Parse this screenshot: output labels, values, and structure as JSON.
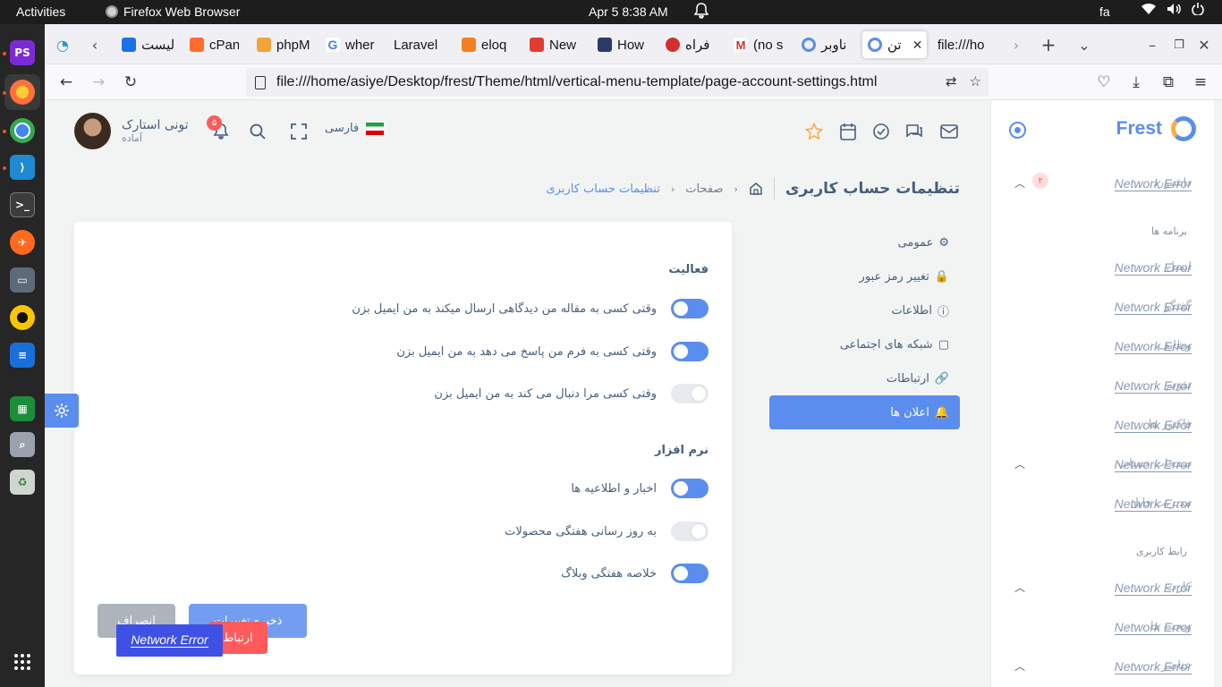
{
  "system_bar": {
    "activities": "Activities",
    "app_name": "Firefox Web Browser",
    "clock": "Apr 5  8:38 AM",
    "input_lang": "fa"
  },
  "browser": {
    "tabs": [
      {
        "label": "لیست",
        "color": "#1a73e8"
      },
      {
        "label": "cPan",
        "color": "#ff6c2c"
      },
      {
        "label": "phpM",
        "color": "#f2a33a"
      },
      {
        "label": "wher",
        "color": "#4285f4"
      },
      {
        "label": "Laravel",
        "color": "#ff2d20"
      },
      {
        "label": "eloq",
        "color": "#f48024"
      },
      {
        "label": "New",
        "color": "#e03c31"
      },
      {
        "label": "How",
        "color": "#2b3a67"
      },
      {
        "label": "فراه",
        "color": "#d32f2f"
      },
      {
        "label": "(no s",
        "color": "#d93025"
      },
      {
        "label": "ناوبر",
        "color": "#5a8dee"
      },
      {
        "label": "تن",
        "color": "#5a8dee"
      },
      {
        "label": "file:///ho",
        "color": "#e0e0e0"
      }
    ],
    "url": "file:///home/asiye/Desktop/frest/Theme/html/vertical-menu-template/page-account-settings.html"
  },
  "header": {
    "user_name": "تونی استارک",
    "user_status": "آماده",
    "notification_count": "۵",
    "language": "فارسی"
  },
  "brand": {
    "name": "Frest",
    "accent": "#5a8dee"
  },
  "menu": {
    "error_text": "Network Error",
    "items": [
      {
        "ghost": "داشبورد",
        "badge": "۲",
        "chevron": true
      },
      {
        "header": "برنامه ها"
      },
      {
        "ghost": "ایمیل"
      },
      {
        "ghost": "گفتگو"
      },
      {
        "ghost": "وظایف"
      },
      {
        "ghost": "تقویم"
      },
      {
        "ghost": "فاکتور ها"
      },
      {
        "ghost": "صفحات حساب",
        "chevron": true
      },
      {
        "ghost": "مدیریت فایل"
      },
      {
        "header": "رابط کاربری"
      },
      {
        "ghost": "کارت",
        "chevron": true
      },
      {
        "ghost": "ویجت ها"
      },
      {
        "ghost": "عناصر",
        "chevron": true
      }
    ]
  },
  "breadcrumb": {
    "title": "تنظیمات حساب کاربری",
    "pages": "صفحات",
    "current": "تنظیمات حساب کاربری"
  },
  "settings_nav": [
    {
      "label": "عمومی",
      "icon": "gear-icon",
      "glyph": "⚙"
    },
    {
      "label": "تغییر رمز عبور",
      "icon": "lock-icon",
      "glyph": "🔒"
    },
    {
      "label": "اطلاعات",
      "icon": "info-icon",
      "glyph": "ⓘ"
    },
    {
      "label": "شبکه های اجتماعی",
      "icon": "twitch-icon",
      "glyph": "▢"
    },
    {
      "label": "ارتباطات",
      "icon": "link-icon",
      "glyph": "🔗"
    },
    {
      "label": "اعلان ها",
      "icon": "bell-icon",
      "glyph": "🔔",
      "active": true
    }
  ],
  "activity": {
    "title": "فعالیت",
    "options": [
      {
        "text": "وقتی کسی به مقاله من دیدگاهی ارسال میکند به من ایمیل بزن",
        "on": true
      },
      {
        "text": "وقتی کسی به فرم من پاسخ می دهد به من ایمیل بزن",
        "on": true
      },
      {
        "text": "وقتی کسی مرا دنبال می کند به من ایمیل بزن",
        "on": false
      }
    ]
  },
  "software": {
    "title": "نرم افزار",
    "options": [
      {
        "text": "اخبار و اطلاعیه ها",
        "on": true
      },
      {
        "text": "به روز رسانی هفتگی محصولات",
        "on": false
      },
      {
        "text": "خلاصه هفتگی وبلاگ",
        "on": true
      }
    ]
  },
  "buttons": {
    "save": "ذخیره تغییرات",
    "cancel": "انصراف",
    "contact": "ارتباط",
    "error_pill": "Network Error"
  }
}
